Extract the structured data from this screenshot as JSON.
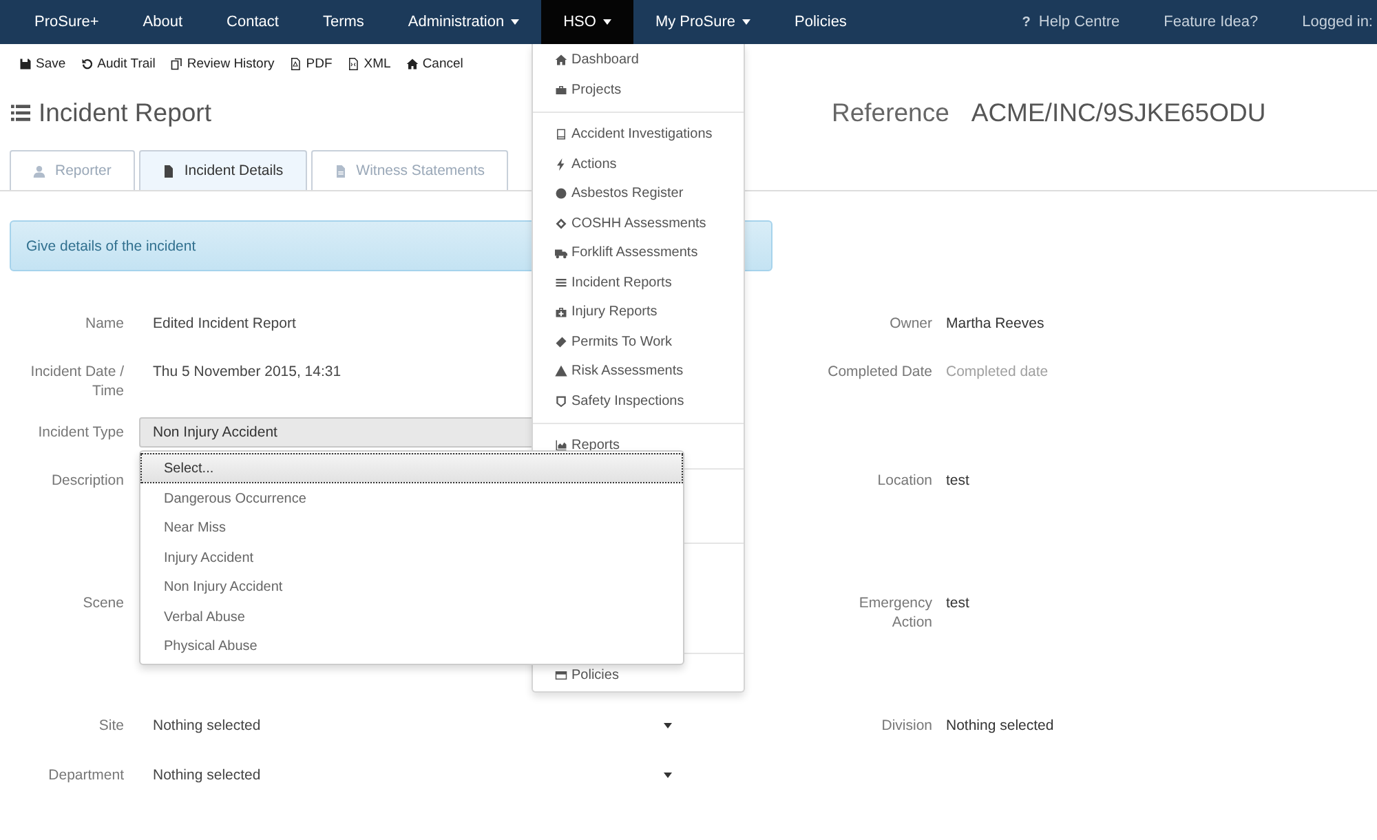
{
  "nav": {
    "items": [
      {
        "label": "ProSure+",
        "dropdown": false,
        "selected": false
      },
      {
        "label": "About",
        "dropdown": false,
        "selected": false
      },
      {
        "label": "Contact",
        "dropdown": false,
        "selected": false
      },
      {
        "label": "Terms",
        "dropdown": false,
        "selected": false
      },
      {
        "label": "Administration",
        "dropdown": true,
        "selected": false
      },
      {
        "label": "HSO",
        "dropdown": true,
        "selected": true
      },
      {
        "label": "My ProSure",
        "dropdown": true,
        "selected": false
      },
      {
        "label": "Policies",
        "dropdown": false,
        "selected": false
      }
    ],
    "right": [
      {
        "icon_text": "?",
        "label": "Help Centre"
      },
      {
        "label": "Feature Idea?"
      },
      {
        "label": "Logged in:"
      }
    ]
  },
  "toolbar": [
    "Save",
    "Audit Trail",
    "Review History",
    "PDF",
    "XML",
    "Cancel"
  ],
  "title": "Incident Report",
  "reference": {
    "label": "Reference",
    "value": "ACME/INC/9SJKE65ODU"
  },
  "tabs": [
    {
      "label": "Reporter",
      "selected": false
    },
    {
      "label": "Incident Details",
      "selected": true
    },
    {
      "label": "Witness Statements",
      "selected": false
    }
  ],
  "alert": "Give details of the incident",
  "form": {
    "rows": [
      {
        "kind": "text",
        "left": {
          "label": "Name",
          "value": "Edited Incident Report"
        },
        "right": {
          "label": "Owner",
          "value": "Martha Reeves"
        }
      },
      {
        "kind": "text",
        "left": {
          "label": "Incident Date / Time",
          "value": "Thu 5 November 2015, 14:31"
        },
        "right": {
          "label": "Completed Date",
          "placeholder": "Completed date"
        }
      },
      {
        "kind": "select",
        "left": {
          "label": "Incident Type",
          "value": "Non Injury Accident"
        }
      },
      {
        "kind": "textarea",
        "left": {
          "label": "Description"
        },
        "right": {
          "label": "Location",
          "value": "test"
        }
      },
      {
        "kind": "textarea",
        "left": {
          "label": "Scene"
        },
        "right": {
          "label": "Emergency Action",
          "value": "test"
        }
      },
      {
        "kind": "dropdown",
        "left": {
          "label": "Site",
          "value": "Nothing selected"
        },
        "right": {
          "label": "Division",
          "value": "Nothing selected"
        }
      },
      {
        "kind": "dropdown",
        "left": {
          "label": "Department",
          "value": "Nothing selected"
        }
      }
    ]
  },
  "type_options": [
    {
      "label": "Select...",
      "selected": true
    },
    {
      "label": "Dangerous Occurrence",
      "selected": false
    },
    {
      "label": "Near Miss",
      "selected": false
    },
    {
      "label": "Injury Accident",
      "selected": false
    },
    {
      "label": "Non Injury Accident",
      "selected": false
    },
    {
      "label": "Verbal Abuse",
      "selected": false
    },
    {
      "label": "Physical Abuse",
      "selected": false
    }
  ],
  "hso_menu": {
    "groups": [
      [
        "Dashboard",
        "Projects"
      ],
      [
        "Accident Investigations",
        "Actions",
        "Asbestos Register",
        "COSHH Assessments",
        "Forklift Assessments",
        "Incident Reports",
        "Injury Reports",
        "Permits To Work",
        "Risk Assessments",
        "Safety Inspections"
      ],
      [
        "Reports"
      ],
      [
        "Policies"
      ]
    ]
  }
}
